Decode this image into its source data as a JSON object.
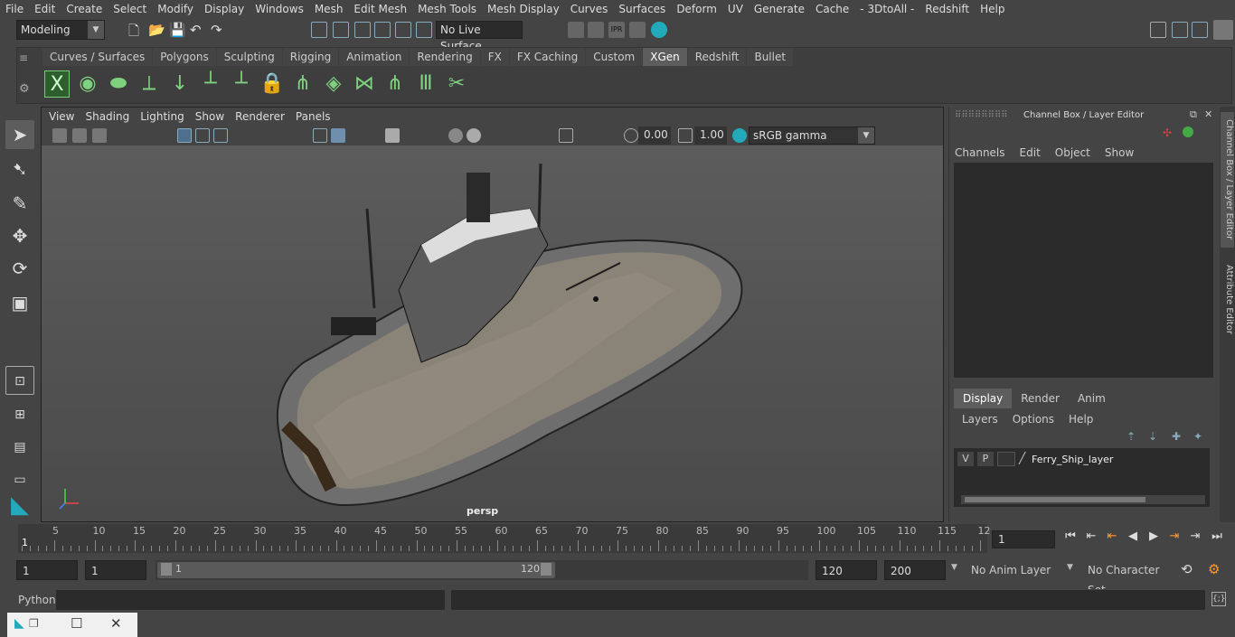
{
  "menubar": [
    "File",
    "Edit",
    "Create",
    "Select",
    "Modify",
    "Display",
    "Windows",
    "Mesh",
    "Edit Mesh",
    "Mesh Tools",
    "Mesh Display",
    "Curves",
    "Surfaces",
    "Deform",
    "UV",
    "Generate",
    "Cache",
    "- 3DtoAll -",
    "Redshift",
    "Help"
  ],
  "status": {
    "mode": "Modeling",
    "live_surface": "No Live Surface"
  },
  "shelf": {
    "tabs": [
      "Curves / Surfaces",
      "Polygons",
      "Sculpting",
      "Rigging",
      "Animation",
      "Rendering",
      "FX",
      "FX Caching",
      "Custom",
      "XGen",
      "Redshift",
      "Bullet"
    ],
    "active_tab": "XGen"
  },
  "viewport": {
    "menu": [
      "View",
      "Shading",
      "Lighting",
      "Show",
      "Renderer",
      "Panels"
    ],
    "exposure": "0.00",
    "gamma": "1.00",
    "color_space": "sRGB gamma",
    "camera_label": "persp"
  },
  "channel_box": {
    "title": "Channel Box / Layer Editor",
    "menu": [
      "Channels",
      "Edit",
      "Object",
      "Show"
    ]
  },
  "layer_editor": {
    "tabs": [
      "Display",
      "Render",
      "Anim"
    ],
    "active_tab": "Display",
    "menu": [
      "Layers",
      "Options",
      "Help"
    ],
    "layer": {
      "v": "V",
      "p": "P",
      "name": "Ferry_Ship_layer"
    }
  },
  "side_tabs": [
    "Channel Box / Layer Editor",
    "Attribute Editor"
  ],
  "timeline": {
    "ticks": [
      "5",
      "10",
      "15",
      "20",
      "25",
      "30",
      "35",
      "40",
      "45",
      "50",
      "55",
      "60",
      "65",
      "70",
      "75",
      "80",
      "85",
      "90",
      "95",
      "100",
      "105",
      "110",
      "115",
      "12"
    ],
    "current_frame_marker": "1",
    "current_frame": "1"
  },
  "range": {
    "start": "1",
    "playback_start": "1",
    "slider_start": "1",
    "slider_end": "120",
    "playback_end": "120",
    "end": "200",
    "anim_layer": "No Anim Layer",
    "character_set": "No Character Set"
  },
  "command_line": {
    "language": "Python"
  }
}
